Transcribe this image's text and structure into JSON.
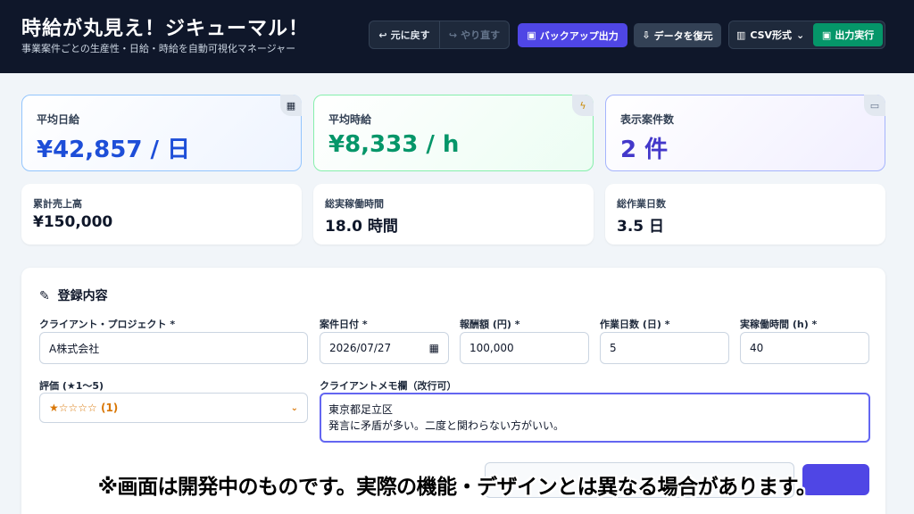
{
  "header": {
    "title": "時給が丸見え！ジキューマル！",
    "subtitle": "事業案件ごとの生産性・日給・時給を自動可視化マネージャー"
  },
  "toolbar": {
    "undo_label": "元に戻す",
    "redo_label": "やり直す",
    "backup_label": "バックアップ出力",
    "restore_label": "データを復元",
    "format_selected": "CSV形式",
    "export_label": "出力実行"
  },
  "stats": {
    "avg_daily": {
      "label": "平均日給",
      "value": "¥42,857 / 日",
      "icon": "calendar-icon"
    },
    "avg_hourly": {
      "label": "平均時給",
      "value": "¥8,333 / h",
      "icon": "lightning-icon"
    },
    "shown_count": {
      "label": "表示案件数",
      "value": "2 件",
      "icon": "folder-icon"
    },
    "total_sales": {
      "label": "累計売上高",
      "value": "¥150,000"
    },
    "total_hours": {
      "label": "総実稼働時間",
      "value": "18.0 時間"
    },
    "total_days": {
      "label": "総作業日数",
      "value": "3.5 日"
    }
  },
  "form": {
    "title": "登録内容",
    "client_label": "クライアント・プロジェクト *",
    "client_value": "A株式会社",
    "date_label": "案件日付 *",
    "date_value": "2026/07/27",
    "fee_label": "報酬額 (円) *",
    "fee_value": "100,000",
    "days_label": "作業日数 (日) *",
    "days_value": "5",
    "hours_label": "実稼働時間 (h) *",
    "hours_value": "40",
    "rating_label": "評価 (★1〜5)",
    "rating_value": "★☆☆☆☆ (1)",
    "memo_label": "クライアントメモ欄（改行可）",
    "memo_line1": "東京都足立区",
    "memo_line2": "発言に矛盾が多い。二度と関わらない方がいい。"
  },
  "disclaimer": "※画面は開発中のものです。実際の機能・デザインとは異なる場合があります。",
  "colors": {
    "header_bg": "#0f172a",
    "accent": "#4f46e5",
    "export_green": "#059669",
    "daily_blue": "#1d4ed8",
    "hourly_green": "#059669",
    "count_indigo": "#4338ca"
  }
}
